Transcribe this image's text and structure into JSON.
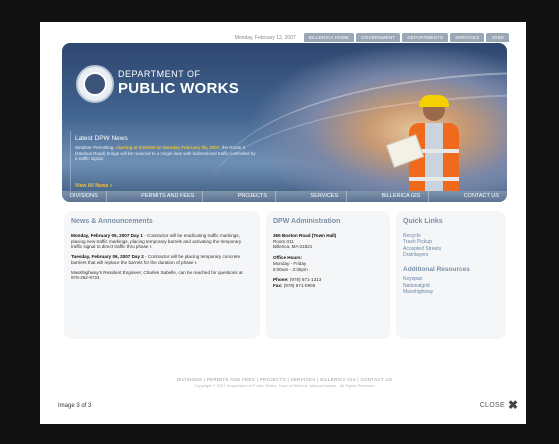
{
  "topbar": {
    "date": "Monday, February 12, 2007",
    "tabs": [
      "Billerica Home",
      "Government",
      "Departments",
      "Services",
      "Jobs"
    ]
  },
  "hero": {
    "dept_line1": "DEPARTMENT OF",
    "dept_line2": "PUBLIC WORKS",
    "news_title": "Latest DPW News",
    "news_lead": "Weather Permitting, ",
    "news_highlight": "starting at 9:00AM on Monday February 05, 2007",
    "news_body": ", the Route 4 (Nashua Road) bridge will be reduced to a single lane with bidirectional traffic controlled by a traffic signal.",
    "news_link": "View All News »"
  },
  "nav": {
    "items": [
      "Divisions",
      "Permits and Fees",
      "Projects",
      "Services",
      "Billerica GIS",
      "Contact Us"
    ]
  },
  "news": {
    "heading": "News & Announcements",
    "p1_bold": "Monday, February 05, 2007 Day 1",
    "p1_text": " - Contractor will be eradicating traffic markings, placing new traffic markings, placing temporary barrels and activating the temporary traffic signal to direct traffic thru phase I.",
    "p2_bold": "Tuesday, February 06, 2007 Day 2",
    "p2_text": " - Contractor will be placing temporary concrete barriers that will replace the barrels for the duration of phase I.",
    "p3_text": "Masshighway's Resident Engineer, Charles Sabelle, can be reached for questions at 978-262-9724."
  },
  "admin": {
    "heading": "DPW Administration",
    "address1": "365 Boston Road (Town Hall)",
    "address2": "Room 011",
    "address3": "Billerica, MA 01821",
    "hours_label": "Office Hours:",
    "hours1": "Monday - Friday",
    "hours2": "8:00am - 3:30pm",
    "phone_label": "Phone:",
    "phone": " (978) 671-1313",
    "fax_label": "Fax:",
    "fax": " (978) 671-0906"
  },
  "quicklinks": {
    "heading": "Quick Links",
    "links": [
      "Recycle",
      "Trash Pickup",
      "Accepted Streets",
      "Drainlayers"
    ],
    "resources_heading": "Additional Resources",
    "resources": [
      "Keyspan",
      "Nationalgrid",
      "Masshighway"
    ]
  },
  "footer": {
    "links": "DIVISIONS  |  PERMITS AND FEES  |  PROJECTS  |  SERVICES  |  BILLERICA GIS  |  CONTACT US",
    "copyright": "Copyright © 2007 Department of Public Works, Town of Billerica, Massachusetts - All Rights Reserved"
  },
  "lightbox": {
    "caption": "Image 3 of 3",
    "close_label": "CLOSE",
    "close_icon": "close-icon"
  }
}
